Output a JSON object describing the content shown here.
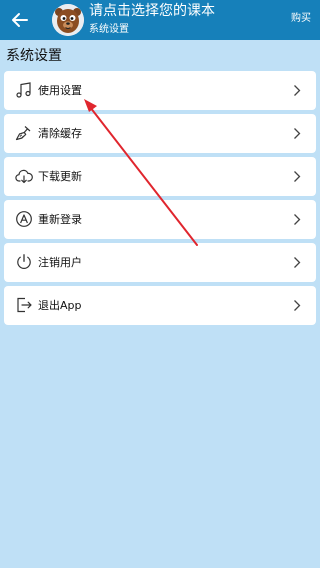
{
  "appbar": {
    "title": "请点击选择您的课本",
    "subtitle": "系统设置",
    "buy_label": "购买",
    "background": "#1680ba"
  },
  "section_title": "系统设置",
  "menu": [
    {
      "label": "使用设置",
      "icon": "music-note-icon"
    },
    {
      "label": "清除缓存",
      "icon": "broom-icon"
    },
    {
      "label": "下载更新",
      "icon": "cloud-download-icon"
    },
    {
      "label": "重新登录",
      "icon": "account-circle-icon"
    },
    {
      "label": "注销用户",
      "icon": "power-icon"
    },
    {
      "label": "退出App",
      "icon": "logout-icon"
    }
  ],
  "annotation": {
    "color": "#e0262e"
  }
}
